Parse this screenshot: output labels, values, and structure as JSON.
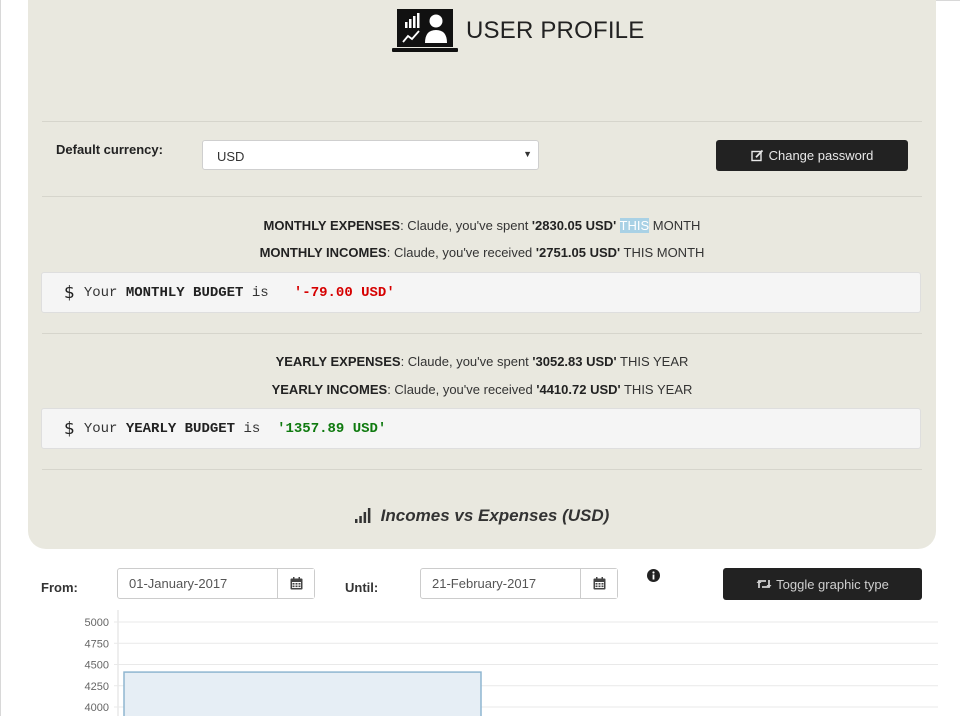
{
  "header": {
    "title": "USER PROFILE",
    "logo_icon": "analytics-user-laptop-icon"
  },
  "currency": {
    "label": "Default currency:",
    "selected": "USD"
  },
  "change_password": {
    "label": "Change password",
    "icon": "edit-icon"
  },
  "monthly": {
    "expenses": {
      "label": "MONTHLY EXPENSES",
      "prefix": ": Claude, you've spent ",
      "amount": "'2830.05 USD'",
      "period_highlight": "THIS",
      "period_rest": " MONTH"
    },
    "incomes": {
      "label": "MONTHLY INCOMES",
      "prefix": ": Claude, you've received ",
      "amount": "'2751.05 USD'",
      "period": " THIS MONTH"
    },
    "budget": {
      "dollar": "$",
      "your": "Your",
      "keyword": "MONTHLY BUDGET",
      "is": "is",
      "value": "'-79.00 USD'"
    }
  },
  "yearly": {
    "expenses": {
      "label": "YEARLY EXPENSES",
      "prefix": ": Claude, you've spent ",
      "amount": "'3052.83 USD'",
      "period": " THIS YEAR"
    },
    "incomes": {
      "label": "YEARLY INCOMES",
      "prefix": ": Claude, you've received ",
      "amount": "'4410.72 USD'",
      "period": " THIS YEAR"
    },
    "budget": {
      "dollar": "$",
      "your": "Your",
      "keyword": "YEARLY BUDGET",
      "is": "is",
      "value": "'1357.89 USD'"
    }
  },
  "chart_section": {
    "title": "Incomes vs Expenses (USD)",
    "icon": "bar-signal-icon"
  },
  "filters": {
    "from_label": "From:",
    "from_value": "01-January-2017",
    "until_label": "Until:",
    "until_value": "21-February-2017",
    "calendar_icon": "calendar-icon",
    "info_icon": "info-icon",
    "toggle_label": "Toggle graphic type",
    "toggle_icon": "retweet-icon"
  },
  "chart_data": {
    "type": "bar",
    "y_ticks": [
      "5000",
      "4750",
      "4500",
      "4250",
      "4000"
    ],
    "visible_y_range": [
      4000,
      5000
    ],
    "series": [
      {
        "values": [
          4410.72
        ]
      }
    ],
    "bar_color": "#e6eef5",
    "bar_border": "#8fb6d0",
    "grid": true
  }
}
